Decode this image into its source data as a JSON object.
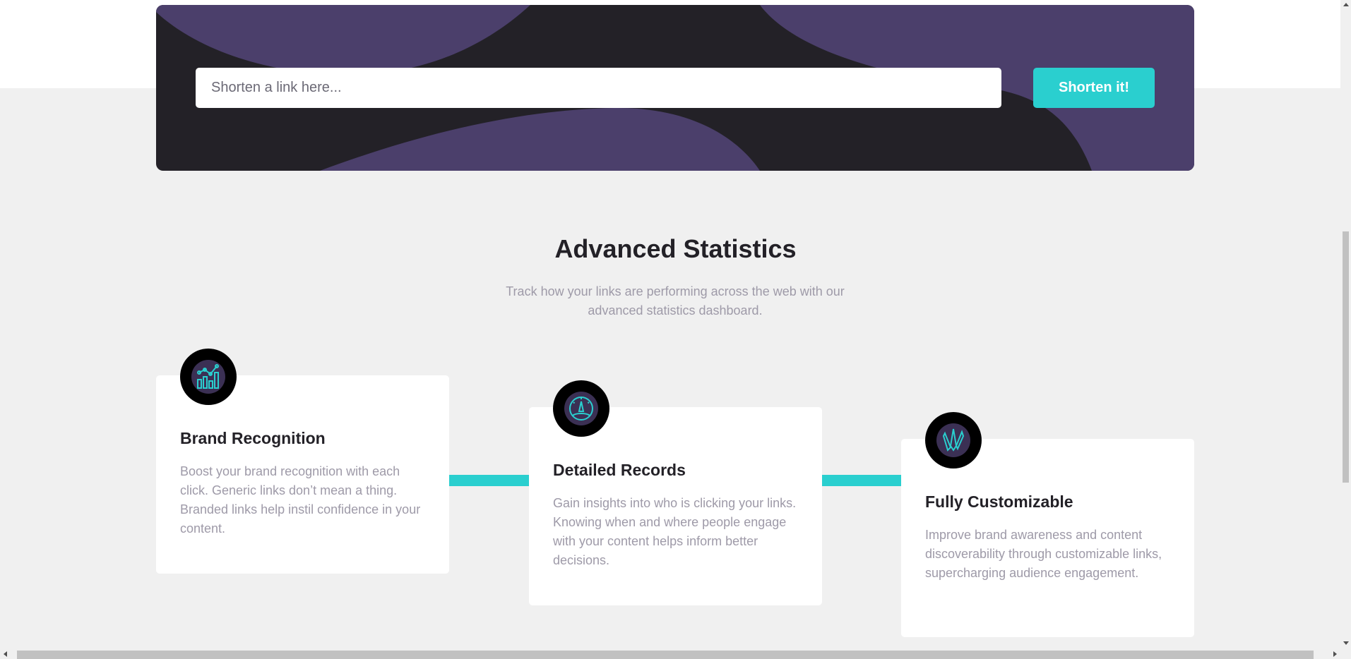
{
  "shorten": {
    "placeholder": "Shorten a link here...",
    "button_label": "Shorten it!"
  },
  "statistics": {
    "title": "Advanced Statistics",
    "subtitle": "Track how your links are performing across the web with our advanced statistics dashboard.",
    "cards": [
      {
        "icon": "brand-recognition-icon",
        "title": "Brand Recognition",
        "text": "Boost your brand recognition with each click. Generic links don’t mean a thing. Branded links help instil confidence in your content."
      },
      {
        "icon": "detailed-records-icon",
        "title": "Detailed Records",
        "text": "Gain insights into who is clicking your links. Knowing when and where people engage with your content helps inform better decisions."
      },
      {
        "icon": "fully-customizable-icon",
        "title": "Fully Customizable",
        "text": "Improve brand awareness and content discoverability through customizable links, supercharging audience engagement."
      }
    ]
  },
  "colors": {
    "cyan": "#2acfcf",
    "dark_violet": "#3b3054",
    "very_dark": "#232127",
    "grayish_violet": "#9e9aa8",
    "background": "#f0f0f0"
  }
}
